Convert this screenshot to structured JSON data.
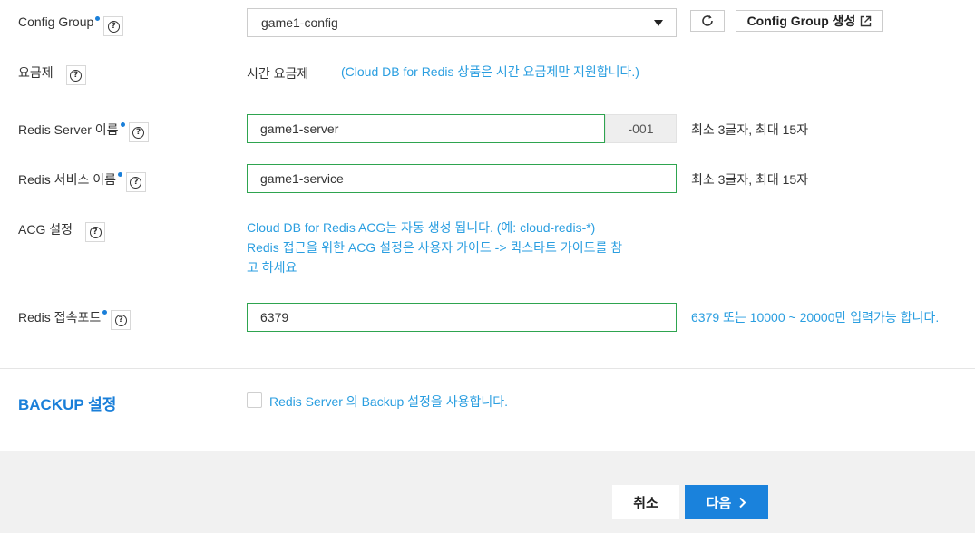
{
  "config_group": {
    "label": "Config Group",
    "selected": "game1-config",
    "create_button": "Config Group 생성"
  },
  "pricing": {
    "label": "요금제",
    "value": "시간 요금제",
    "note": "(Cloud DB for Redis 상품은 시간 요금제만 지원합니다.)"
  },
  "server_name": {
    "label": "Redis Server 이름",
    "value": "game1-server",
    "suffix": "-001",
    "hint": "최소 3글자, 최대 15자"
  },
  "service_name": {
    "label": "Redis 서비스 이름",
    "value": "game1-service",
    "hint": "최소 3글자, 최대 15자"
  },
  "acg": {
    "label": "ACG 설정",
    "note_line1": "Cloud DB for Redis ACG는 자동 생성 됩니다. (예: cloud-redis-*)",
    "note_line2": "Redis 접근을 위한 ACG 설정은 사용자 가이드 -> 퀵스타트 가이드를 참",
    "note_line3": "고 하세요"
  },
  "port": {
    "label": "Redis 접속포트",
    "value": "6379",
    "hint": "6379 또는 10000 ~ 20000만 입력가능 합니다."
  },
  "backup": {
    "title": "BACKUP 설정",
    "checkbox_label": "Redis Server 의 Backup 설정을 사용합니다."
  },
  "footer": {
    "cancel": "취소",
    "next": "다음"
  },
  "colors": {
    "accent": "#1a82dc",
    "note_blue": "#2a9ee0",
    "input_border_valid": "#2ea44f"
  }
}
